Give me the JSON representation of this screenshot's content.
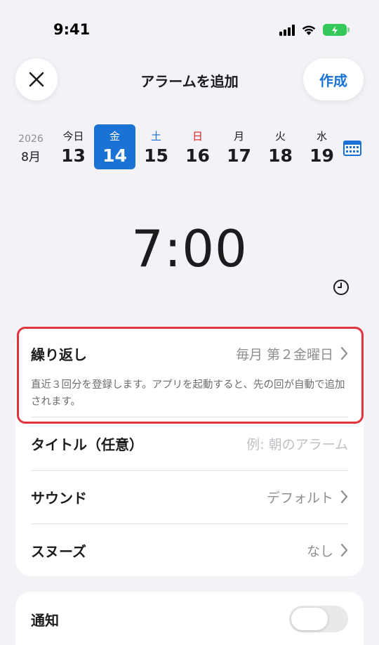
{
  "status_bar": {
    "time": "9:41"
  },
  "nav": {
    "title": "アラームを追加",
    "create_label": "作成",
    "close_icon": "close-icon"
  },
  "date_strip": {
    "year": "2026",
    "month": "8月",
    "days": [
      {
        "dow": "今日",
        "num": "13",
        "kind": "normal"
      },
      {
        "dow": "金",
        "num": "14",
        "kind": "selected"
      },
      {
        "dow": "土",
        "num": "15",
        "kind": "sat"
      },
      {
        "dow": "日",
        "num": "16",
        "kind": "sun"
      },
      {
        "dow": "月",
        "num": "17",
        "kind": "normal"
      },
      {
        "dow": "火",
        "num": "18",
        "kind": "normal"
      },
      {
        "dow": "水",
        "num": "19",
        "kind": "normal"
      }
    ],
    "calendar_icon": "calendar-icon"
  },
  "time_picker": {
    "time": "7:00",
    "clock_icon": "clock-icon"
  },
  "settings": {
    "repeat": {
      "label": "繰り返し",
      "value": "毎月 第２金曜日",
      "description": "直近３回分を登録します。アプリを起動すると、先の回が自動で追加されます。"
    },
    "title": {
      "label": "タイトル（任意）",
      "placeholder": "例: 朝のアラーム"
    },
    "sound": {
      "label": "サウンド",
      "value": "デフォルト"
    },
    "snooze": {
      "label": "スヌーズ",
      "value": "なし"
    }
  },
  "notification": {
    "label": "通知",
    "enabled": false
  },
  "colors": {
    "accent": "#1a73d4",
    "sunday": "#e02020",
    "highlight": "#e0353b",
    "battery": "#34c759"
  }
}
